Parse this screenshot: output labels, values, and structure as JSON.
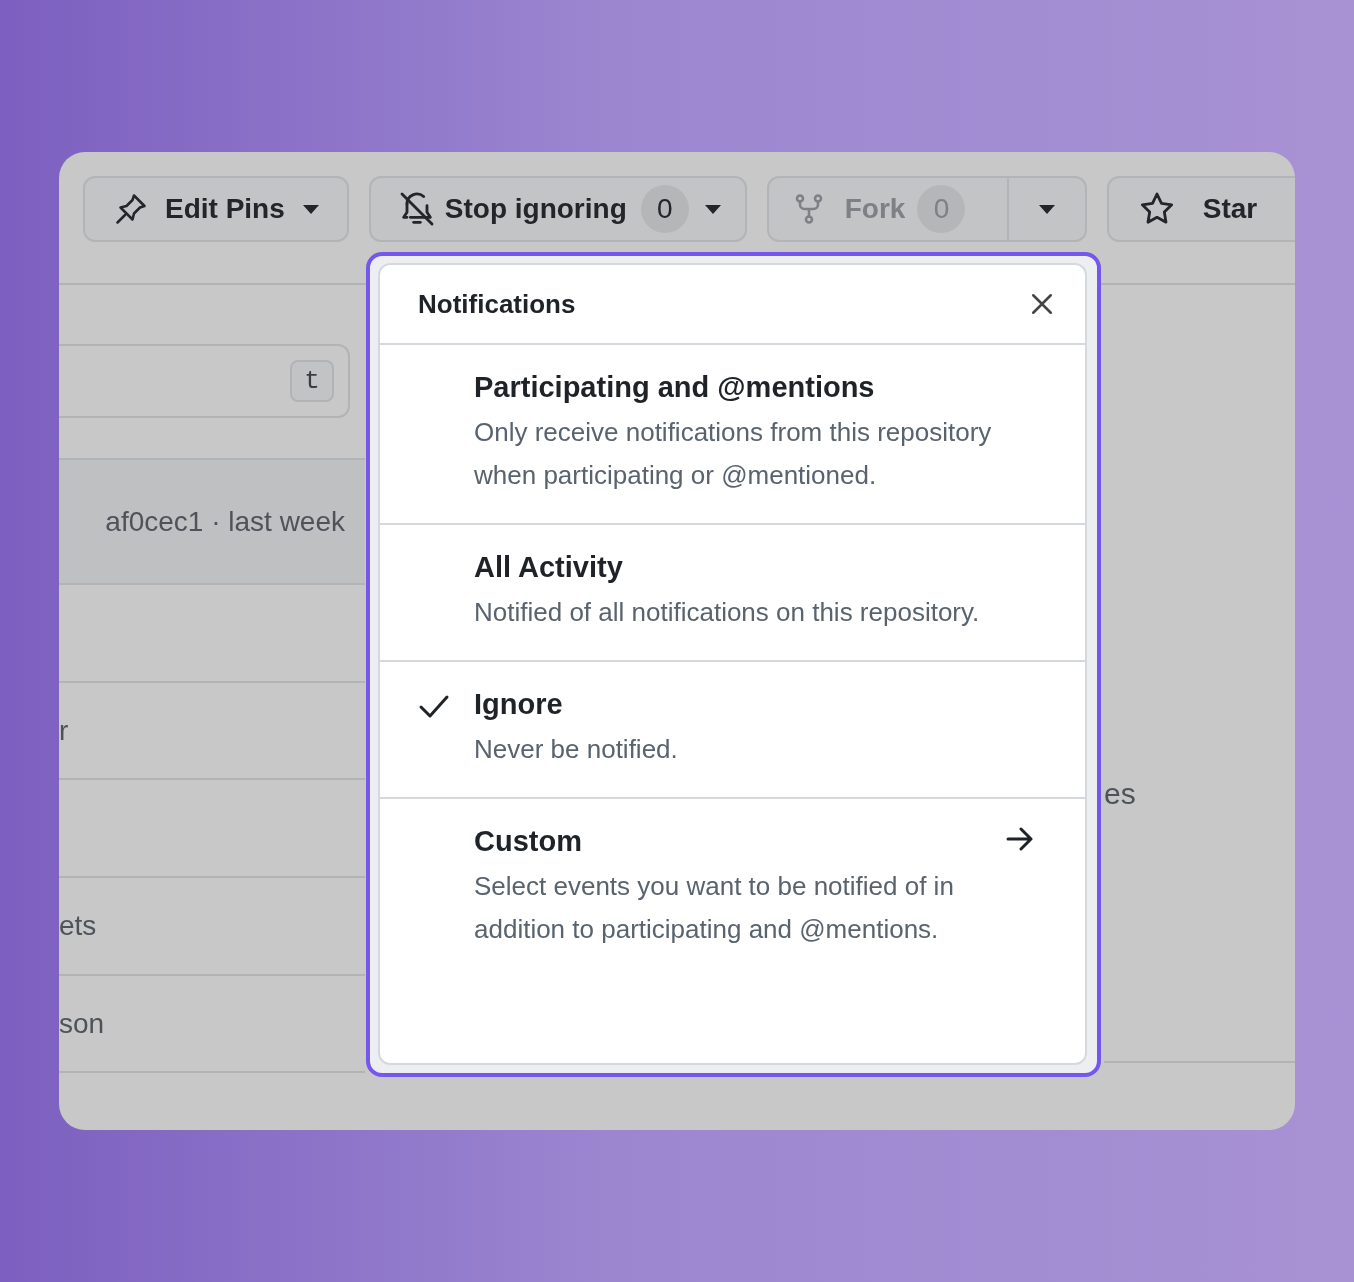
{
  "toolbar": [
    {
      "kind": "pins",
      "label": "Edit Pins",
      "disabled": false
    },
    {
      "kind": "watch",
      "label": "Stop ignoring",
      "count": "0",
      "disabled": false
    },
    {
      "kind": "fork",
      "label": "Fork",
      "count": "0",
      "disabled": true
    },
    {
      "kind": "star",
      "label": "Star",
      "disabled": false
    }
  ],
  "background": {
    "search_key_hint": "t",
    "commit": "af0cec1 · last week",
    "rows": [
      "r",
      "ets",
      "son"
    ],
    "side_text": "es"
  },
  "notifications": {
    "title": "Notifications",
    "options": [
      {
        "kind": "option",
        "title": "Participating and @mentions",
        "description": "Only receive notifications from this repository when participating or @mentioned.",
        "selected": false
      },
      {
        "kind": "option",
        "title": "All Activity",
        "description": "Notified of all notifications on this repository.",
        "selected": false
      },
      {
        "kind": "option",
        "title": "Ignore",
        "description": "Never be notified.",
        "selected": true
      },
      {
        "kind": "submenu",
        "title": "Custom",
        "description": "Select events you want to be notified of in addition to participating and @mentions.",
        "selected": false
      }
    ]
  }
}
